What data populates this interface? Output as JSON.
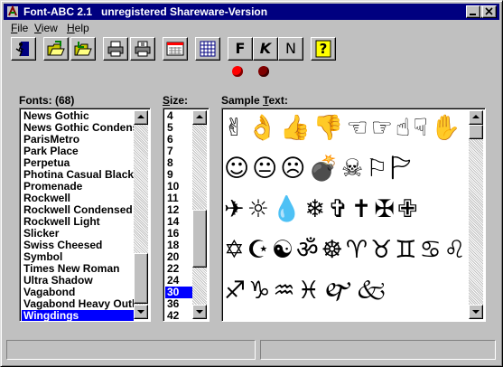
{
  "window": {
    "title": "Font-ABC 2.1   unregistered Shareware-Version",
    "controls": [
      "minimize",
      "maximize",
      "close"
    ]
  },
  "menu": [
    {
      "label": "File",
      "underline": "F",
      "rest": "ile"
    },
    {
      "label": "View",
      "underline": "V",
      "rest": "iew"
    },
    {
      "label": "Help",
      "underline": "H",
      "rest": "elp"
    }
  ],
  "toolbar": {
    "buttons": [
      {
        "name": "exit-door-icon"
      },
      {
        "name": "open-folder-icon"
      },
      {
        "name": "install-folder-icon"
      },
      {
        "name": "print-icon"
      },
      {
        "name": "print-preview-icon"
      },
      {
        "name": "keyboard-icon"
      },
      {
        "name": "grid-icon"
      },
      {
        "name": "bold-f",
        "text": "F"
      },
      {
        "name": "italic-k",
        "text": "K"
      },
      {
        "name": "normal-n",
        "text": "N"
      },
      {
        "name": "help-icon",
        "text": "?"
      }
    ],
    "indicator_colors": [
      "#ff0000",
      "#800000"
    ]
  },
  "labels": {
    "fonts": "Fonts: (68)",
    "size": "Size:",
    "sample": "Sample Text:"
  },
  "fonts": [
    "News Gothic",
    "News Gothic Condens",
    "ParisMetro",
    "Park Place",
    "Perpetua",
    "Photina Casual Black",
    "Promenade",
    "Rockwell",
    "Rockwell Condensed",
    "Rockwell Light",
    "Slicker",
    "Swiss Cheesed",
    "Symbol",
    "Times New Roman",
    "Ultra Shadow",
    "Vagabond",
    "Vagabond Heavy Outl",
    "Wingdings"
  ],
  "selected_font": "Wingdings",
  "sizes": [
    "4",
    "5",
    "6",
    "7",
    "8",
    "9",
    "10",
    "11",
    "12",
    "14",
    "16",
    "18",
    "20",
    "22",
    "24",
    "30",
    "36",
    "42"
  ],
  "selected_size": "30",
  "sample_glyph_rows": [
    "✌👌👍👎☜☞☝☟✋",
    "☺😐☹💣☠⚐🏱",
    "✈☼💧❄✞✝✠✙",
    "✡☪☯ॐ☸♈♉♊♋♌♍♎♏",
    "♐♑♒♓🙰🙵"
  ],
  "accent": "#000080",
  "selection": "#0000ff"
}
